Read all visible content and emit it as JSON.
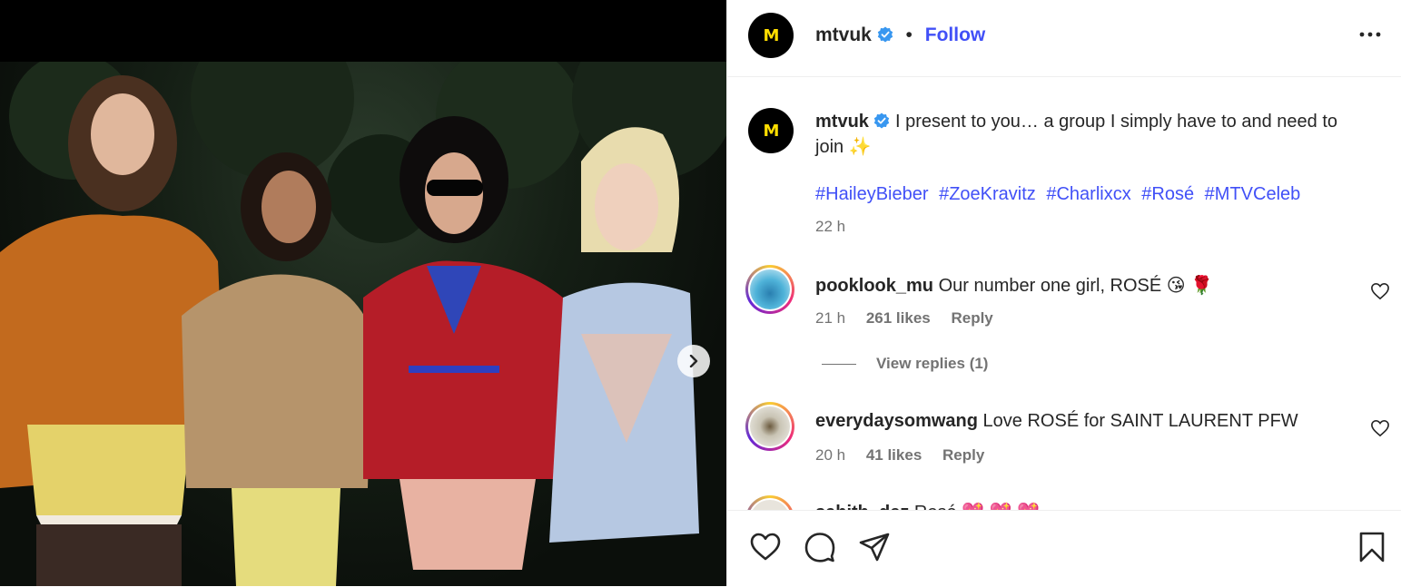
{
  "header": {
    "username": "mtvuk",
    "separator": "•",
    "follow_label": "Follow",
    "avatar_logo": "M"
  },
  "caption": {
    "username": "mtvuk",
    "text": "I present to you… a group I simply have to and need to join ✨",
    "hashtags": [
      "#HaileyBieber",
      "#ZoeKravitz",
      "#Charlixcx",
      "#Rosé",
      "#MTVCeleb"
    ],
    "time": "22 h"
  },
  "comments": [
    {
      "username": "pooklook_mu",
      "text": "Our number one girl, ROSÉ 😘 🌹",
      "time": "21 h",
      "likes": "261 likes",
      "reply": "Reply"
    },
    {
      "username": "everydaysomwang",
      "text": "Love ROSÉ for SAINT LAURENT PFW",
      "time": "20 h",
      "likes": "41 likes",
      "reply": "Reply"
    },
    {
      "username": "sahith_dez",
      "text": "Rosé 💖 💖 💖"
    }
  ],
  "view_replies": "View replies (1)",
  "colors": {
    "link": "#4150f7",
    "muted": "#737373",
    "text": "#262626"
  },
  "icons": [
    "verified-badge-icon",
    "more-options-icon",
    "heart-icon",
    "comment-icon",
    "share-icon",
    "bookmark-icon",
    "chevron-right-icon"
  ]
}
